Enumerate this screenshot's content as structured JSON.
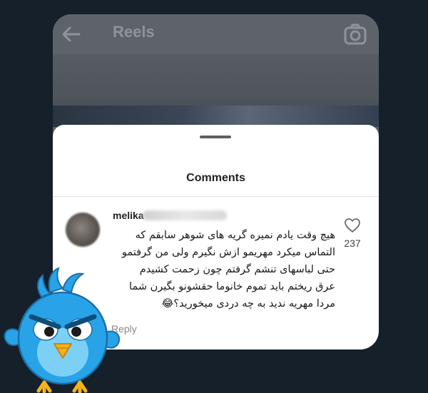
{
  "header": {
    "title": "Reels",
    "back_icon": "arrow-left-icon",
    "camera_icon": "camera-icon"
  },
  "comments_sheet": {
    "title": "Comments"
  },
  "comment": {
    "username": "melika",
    "text_lines": [
      "هیچ وقت یادم نمیره گریه های شوهر سابقم که",
      "التماس میکرد مهریمو ازش نگیرم ولی من گرفتمو",
      "حتی لباسهای تنشم گرفتم چون زحمت کشیدم",
      "عرق ریختم باید تموم خانوما حقشونو بگیرن شما",
      "مردا مهریه ندید به چه دردی میخورید؟😂"
    ],
    "like_count": "237",
    "like_icon": "heart-outline-icon",
    "reply_label": "Reply"
  },
  "colors": {
    "background": "#15202a",
    "sheet": "#ffffff",
    "header_text": "#8e949a",
    "mascot_blue": "#29a3e8"
  }
}
